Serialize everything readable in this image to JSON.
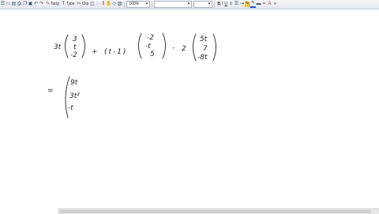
{
  "toolbar": {
    "pen_label": "Tarig",
    "type_label": "Type",
    "clip_label": "Clip",
    "zoom": "100%",
    "bold": "B",
    "italic": "I",
    "underline": "U"
  },
  "ink": {
    "color": "#222222",
    "row1": {
      "coef1": "3t",
      "v1": [
        "3",
        "t",
        "-2"
      ],
      "plus": "+",
      "coef2": "(t-1)",
      "v2": [
        "-2",
        "-t",
        "5"
      ],
      "minus": "-",
      "coef3": "2",
      "v3": [
        "5t",
        "7",
        "-8t"
      ]
    },
    "row2": {
      "equals": "=",
      "v": [
        "9t",
        "3t²",
        "-t"
      ]
    }
  }
}
